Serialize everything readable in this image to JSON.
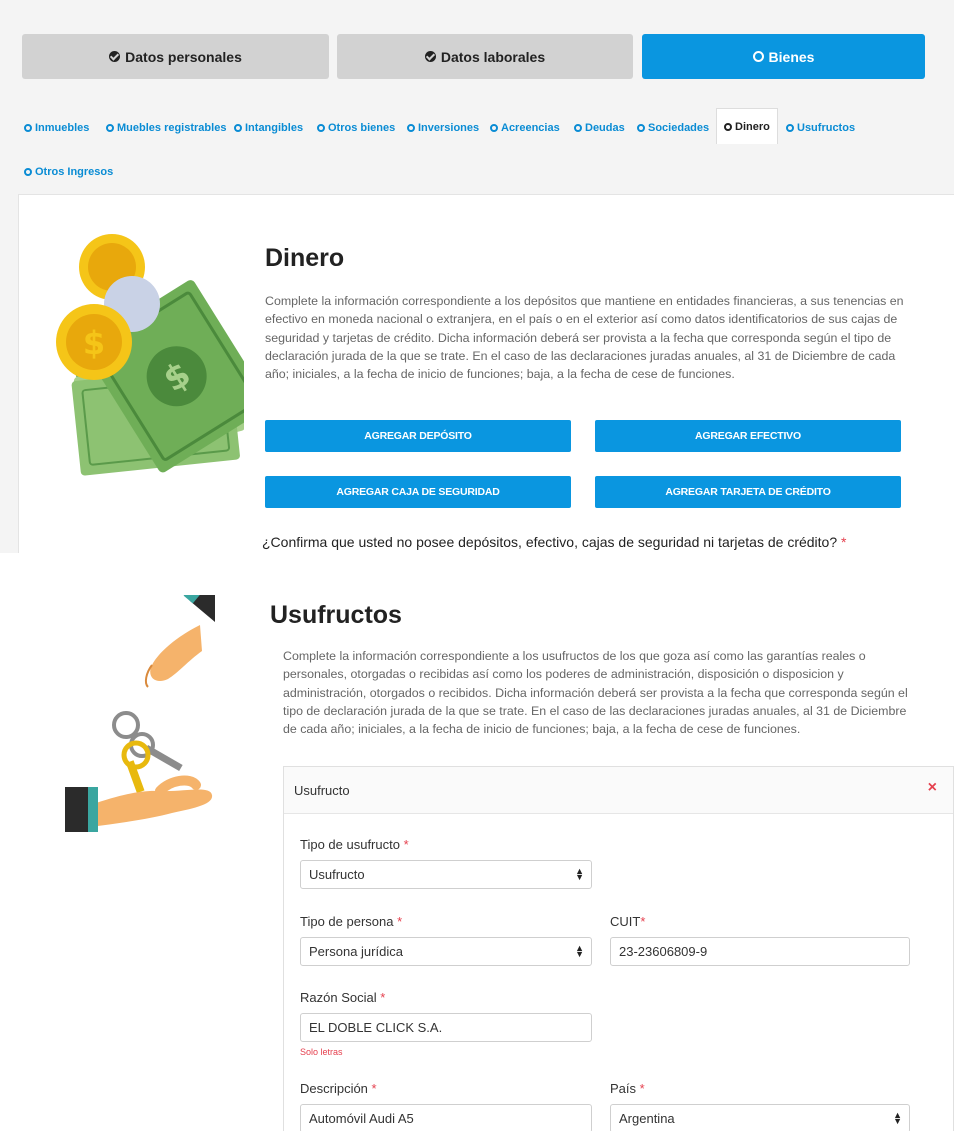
{
  "tabs": [
    {
      "label": "Datos personales",
      "active": false
    },
    {
      "label": "Datos laborales",
      "active": false
    },
    {
      "label": "Bienes",
      "active": true
    }
  ],
  "subnav": [
    "Inmuebles",
    "Muebles registrables",
    "Intangibles",
    "Otros bienes",
    "Inversiones",
    "Acreencias",
    "Deudas",
    "Sociedades",
    "Dinero",
    "Usufructos",
    "Otros Ingresos"
  ],
  "subnav_active": "Dinero",
  "dinero": {
    "title": "Dinero",
    "description": "Complete la información correspondiente a los depósitos que mantiene en entidades financieras, a sus tenencias en efectivo en moneda nacional o extranjera, en el país o en el exterior así como datos identificatorios de sus cajas de seguridad y tarjetas de crédito. Dicha información deberá ser provista a la fecha que corresponda según el tipo de declaración jurada de la que se trate. En el caso de las declaraciones juradas anuales, al 31 de Diciembre de cada año; iniciales, a la fecha de inicio de funciones; baja, a la fecha de cese de funciones.",
    "buttons": {
      "deposito": "AGREGAR DEPÓSITO",
      "efectivo": "AGREGAR EFECTIVO",
      "caja": "AGREGAR CAJA DE SEGURIDAD",
      "tarjeta": "AGREGAR TARJETA DE CRÉDITO"
    },
    "confirm": "¿Confirma que usted no posee depósitos, efectivo, cajas de seguridad ni tarjetas de crédito?",
    "required_mark": "*"
  },
  "usufructos": {
    "title": "Usufructos",
    "description": "Complete la información correspondiente a los usufructos de los que goza así como las garantías reales o personales, otorgadas o recibidas así como los poderes de administración, disposición o disposicion y administración, otorgados o recibidos. Dicha información deberá ser provista a la fecha que corresponda según el tipo de declaración jurada de la que se trate. En el caso de las declaraciones juradas anuales, al 31 de Diciembre de cada año; iniciales, a la fecha de inicio de funciones; baja, a la fecha de cese de funciones.",
    "panel_title": "Usufructo",
    "close": "×",
    "form": {
      "tipo_usufructo_label": "Tipo de usufructo",
      "tipo_usufructo_value": "Usufructo",
      "tipo_persona_label": "Tipo de persona",
      "tipo_persona_value": "Persona jurídica",
      "cuit_label": "CUIT",
      "cuit_value": "23-23606809-9",
      "razon_label": "Razón Social",
      "razon_value": "EL DOBLE CLICK S.A.",
      "razon_hint": "Solo letras",
      "descripcion_label": "Descripción",
      "descripcion_value": "Automóvil Audi A5",
      "pais_label": "País",
      "pais_value": "Argentina",
      "required_mark": "*"
    }
  },
  "colors": {
    "primary": "#0a96e0",
    "link": "#0a8cd4",
    "required": "#e5404e",
    "tab_gray": "#d2d2d2"
  }
}
